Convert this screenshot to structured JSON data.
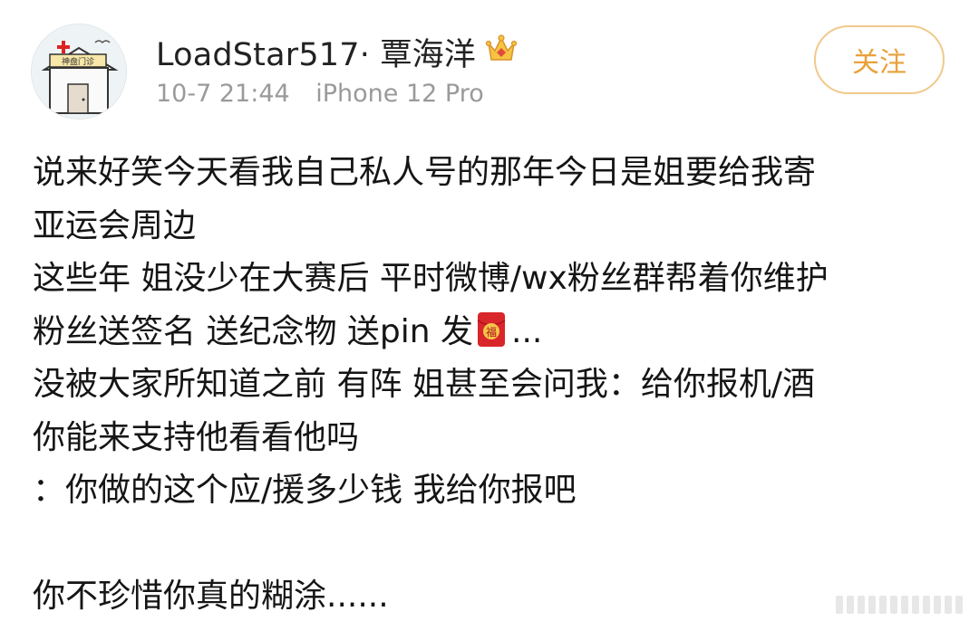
{
  "post": {
    "author": {
      "name": "LoadStar517· 覃海洋",
      "avatar_label": "神盘门诊",
      "badge_icon": "crown-icon"
    },
    "time": "10-7 21:44",
    "device": "iPhone 12 Pro",
    "follow_label": "关注",
    "body": {
      "line1": "说来好笑今天看我自己私人号的那年今日是姐要给我寄",
      "line2": "亚运会周边",
      "line3": "这些年 姐没少在大赛后 平时微博/wx粉丝群帮着你维护",
      "line4a": "粉丝送签名 送纪念物 送pin 发",
      "line4_icon_text": "福",
      "line4b": "...",
      "line5": "没被大家所知道之前 有阵 姐甚至会问我：给你报机/酒",
      "line6": "你能来支持他看看他吗",
      "line7": "：你做的这个应/援多少钱 我给你报吧",
      "line9": "你不珍惜你真的糊涂......"
    }
  },
  "colors": {
    "accent": "#e8a13a",
    "follow_border": "#f0c98a",
    "meta_text": "#9a9a9a",
    "hongbao": "#d8262b"
  }
}
